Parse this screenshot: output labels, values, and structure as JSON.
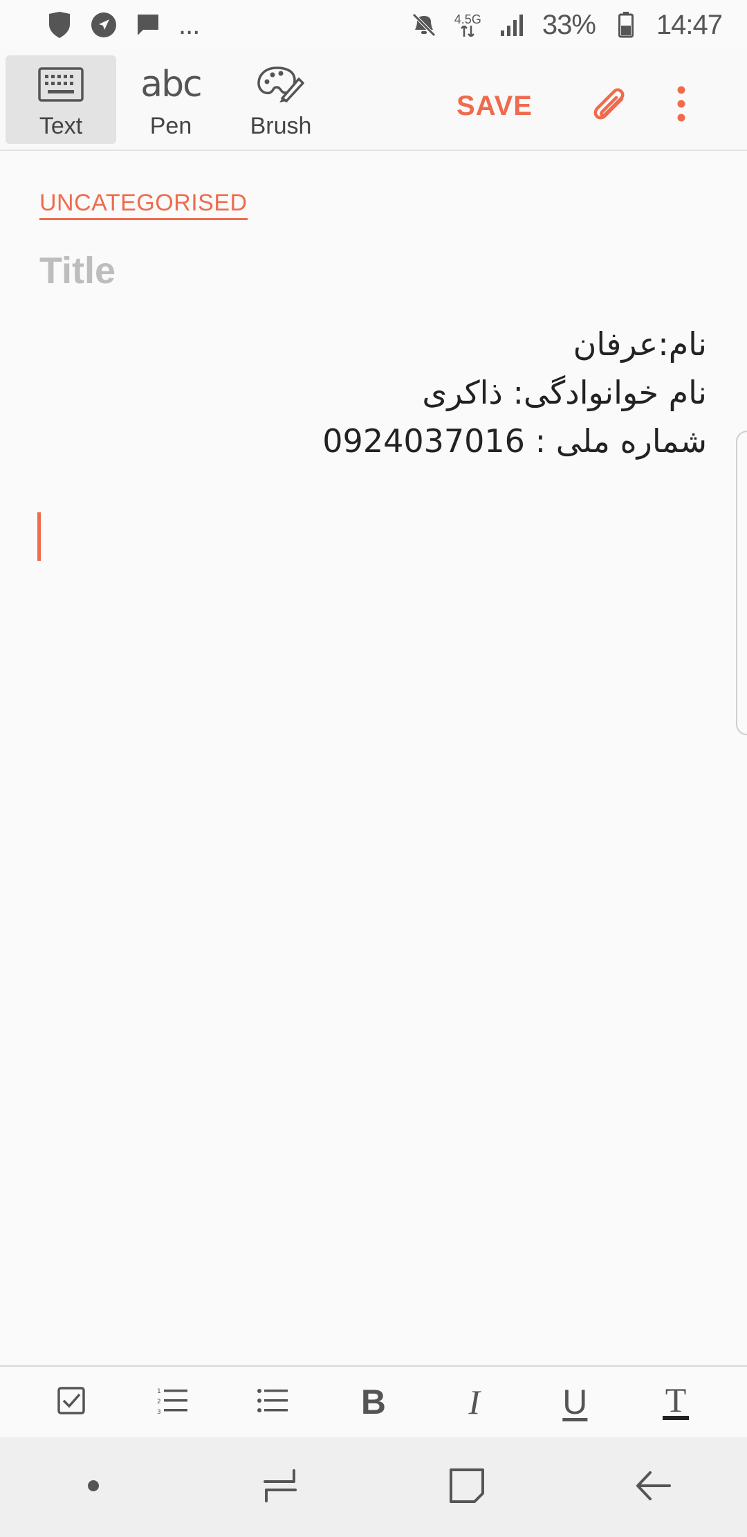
{
  "status_bar": {
    "left_icons": [
      "shield-icon",
      "navigation-icon",
      "message-icon"
    ],
    "more_label": "...",
    "right_icons": [
      "mute-icon",
      "data-arrows-icon",
      "signal-icon",
      "battery-icon"
    ],
    "network": "4.5G",
    "battery": "33%",
    "time": "14:47"
  },
  "toolbar": {
    "modes": [
      {
        "label": "Text",
        "icon": "keyboard-icon",
        "active": true
      },
      {
        "label": "Pen",
        "icon": "abc-pen-icon",
        "glyph": "abc",
        "active": false
      },
      {
        "label": "Brush",
        "icon": "palette-brush-icon",
        "active": false
      }
    ],
    "save_label": "SAVE",
    "attach_icon": "paperclip-icon",
    "more_icon": "more-vert-icon"
  },
  "note": {
    "category": "UNCATEGORISED",
    "title_placeholder": "Title",
    "body_lines": [
      "نام:عرفان",
      "نام خوانوادگی: ذاکری",
      "شماره ملی : 0924037016"
    ]
  },
  "format_bar": {
    "items": [
      {
        "name": "checkbox-icon"
      },
      {
        "name": "numbered-list-icon"
      },
      {
        "name": "bulleted-list-icon"
      },
      {
        "name": "bold",
        "label": "B"
      },
      {
        "name": "italic",
        "label": "I"
      },
      {
        "name": "underline",
        "label": "U"
      },
      {
        "name": "text-color",
        "label": "T"
      }
    ]
  },
  "nav_bar": {
    "items": [
      "dot-icon",
      "recent-apps-icon",
      "home-icon",
      "back-icon"
    ]
  },
  "colors": {
    "accent": "#ef6b4e",
    "placeholder": "#bdbdbd",
    "background": "#fafafa"
  }
}
